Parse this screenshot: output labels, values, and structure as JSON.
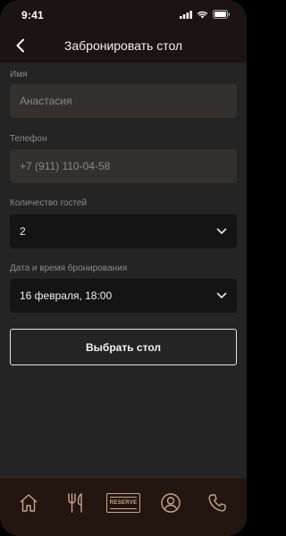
{
  "status_bar": {
    "time": "9:41"
  },
  "nav": {
    "title": "Забронировать стол",
    "back_icon": "chevron-left-icon"
  },
  "form": {
    "name": {
      "label": "Имя",
      "placeholder": "Анастасия"
    },
    "phone": {
      "label": "Телефон",
      "placeholder": "+7 (911) 110-04-58"
    },
    "guests": {
      "label": "Количество гостей",
      "value": "2"
    },
    "datetime": {
      "label": "Дата и время бронирования",
      "value": "16 февраля, 18:00"
    },
    "submit_label": "Выбрать стол"
  },
  "bottom_nav": {
    "items": [
      {
        "icon": "home-icon"
      },
      {
        "icon": "fork-knife-icon"
      },
      {
        "icon": "reserve-icon",
        "label": "RESERVE"
      },
      {
        "icon": "profile-icon"
      },
      {
        "icon": "phone-icon"
      }
    ]
  },
  "colors": {
    "accent": "#c9a68a",
    "bar_bg": "#1c1412",
    "page_bg": "#242424"
  }
}
